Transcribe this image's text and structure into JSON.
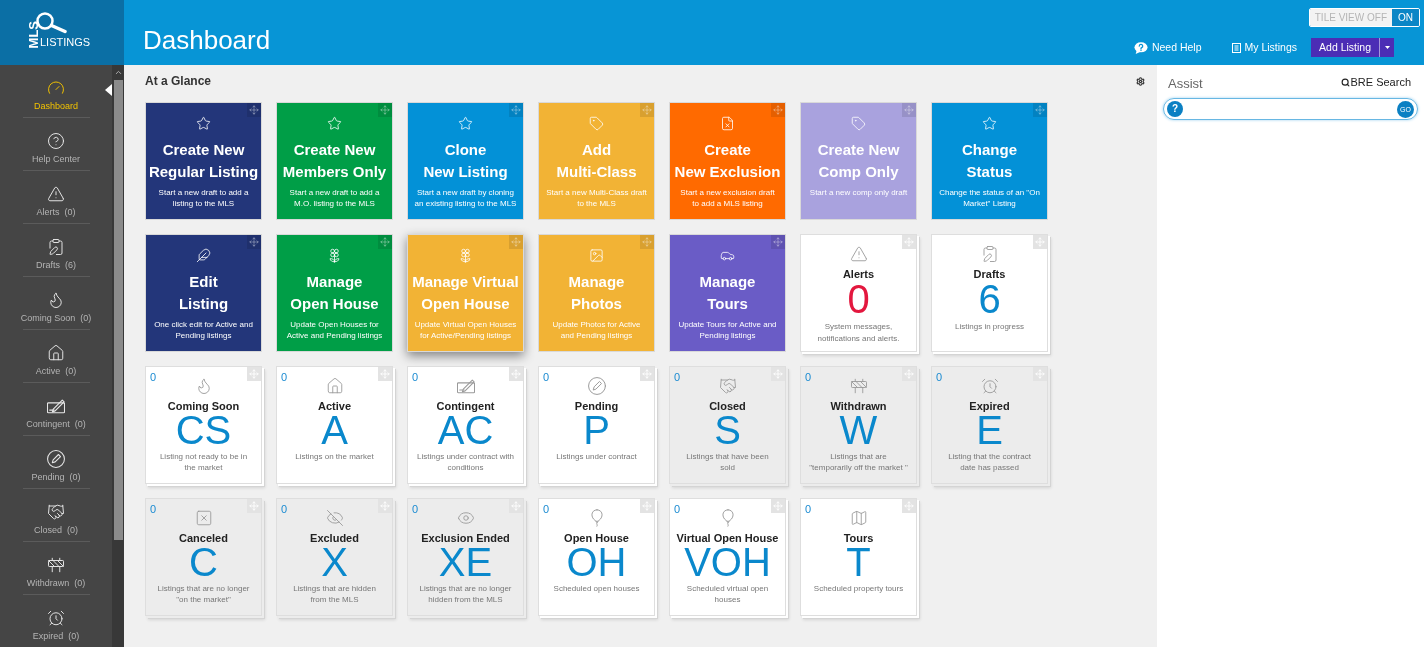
{
  "logo": {
    "vertical_text": "MLS",
    "text": "LISTINGS"
  },
  "header": {
    "title": "Dashboard",
    "tile_view_toggle": {
      "off_label": "TILE VIEW OFF",
      "on_label": "ON",
      "on": true
    },
    "links": [
      {
        "kind": "help",
        "label": "Need Help"
      },
      {
        "kind": "listings",
        "label": "My Listings"
      }
    ],
    "add_listing": {
      "label": "Add Listing"
    }
  },
  "sidebar": {
    "items": [
      {
        "kind": "dashboard",
        "label": "Dashboard",
        "selected": true
      },
      {
        "kind": "help",
        "label": "Help Center",
        "selected": false
      },
      {
        "kind": "alerts",
        "label": "Alerts",
        "count": "(0)",
        "selected": false
      },
      {
        "kind": "drafts",
        "label": "Drafts",
        "count": "(6)",
        "selected": false
      },
      {
        "kind": "upcoming",
        "label": "Coming Soon",
        "count": "(0)",
        "selected": false
      },
      {
        "kind": "active",
        "label": "Active",
        "count": "(0)",
        "selected": false
      },
      {
        "kind": "contingent",
        "label": "Contingent",
        "count": "(0)",
        "selected": false
      },
      {
        "kind": "pending",
        "label": "Pending",
        "count": "(0)",
        "selected": false
      },
      {
        "kind": "closed",
        "label": "Closed",
        "count": "(0)",
        "selected": false
      },
      {
        "kind": "withdrawn",
        "label": "Withdrawn",
        "count": "(0)",
        "selected": false
      },
      {
        "kind": "expired",
        "label": "Expired",
        "count": "(0)",
        "selected": false
      }
    ]
  },
  "glance": {
    "title": "At a Glance",
    "tiles": [
      {
        "kind": "create",
        "title": [
          "Create New",
          "Regular Listing"
        ],
        "description": "Start a new draft to add a listing to the MLS",
        "color": "#23367a",
        "hovered": false
      },
      {
        "kind": "create",
        "title": [
          "Create New",
          "Members Only"
        ],
        "description": "Start a new draft to add a M.O. listing to the MLS",
        "color": "#009e47",
        "hovered": false
      },
      {
        "kind": "clone",
        "title": [
          "Clone",
          "New Listing"
        ],
        "description": "Start a new draft by cloning an existing listing to the MLS",
        "color": "#0391d7",
        "hovered": false
      },
      {
        "kind": "multiclass",
        "title": [
          "Add",
          "Multi-Class"
        ],
        "description": "Start a new Multi-Class draft to the MLS",
        "color": "#f2b335",
        "hovered": false
      },
      {
        "kind": "exclusion",
        "title": [
          "Create",
          "New Exclusion"
        ],
        "description": "Start a new exclusion draft to add a MLS listing",
        "color": "#ff6a00",
        "hovered": false
      },
      {
        "kind": "comp",
        "title": [
          "Create New",
          "Comp Only"
        ],
        "description": "Start a new comp only draft",
        "color": "#a9a2de",
        "hovered": false
      },
      {
        "kind": "status",
        "title": [
          "Change",
          "Status"
        ],
        "description": "Change the status of an \"On Market\" Listing",
        "color": "#0391d7",
        "hovered": false
      },
      {
        "kind": "edit",
        "title": [
          "Edit",
          "Listing"
        ],
        "description": "One click edit for Active and Pending listings",
        "color": "#23367a",
        "hovered": false
      },
      {
        "kind": "manageopenhouse",
        "title": [
          "Manage",
          "Open House"
        ],
        "description": "Update Open Houses for Active and Pending listings",
        "color": "#009e47",
        "hovered": false
      },
      {
        "kind": "managevirtual",
        "title": [
          "Manage Virtual",
          "Open House"
        ],
        "description": "Update Virtual Open Houses for Active/Pending listings",
        "color": "#f2b335",
        "hovered": true
      },
      {
        "kind": "managephotos",
        "title": [
          "Manage",
          "Photos"
        ],
        "description": "Update Photos for Active and Pending listings",
        "color": "#f2b335",
        "hovered": false
      },
      {
        "kind": "managetours",
        "title": [
          "Manage",
          "Tours"
        ],
        "description": "Update Tours for Active and Pending listings",
        "color": "#6a5cc6",
        "hovered": false
      },
      {
        "kind": "alerts",
        "label": "Alerts",
        "value": "0",
        "color": "#e3173e",
        "description": "System messages, notifications and alerts.",
        "hovered": false
      },
      {
        "kind": "drafts",
        "label": "Drafts",
        "value": "6",
        "color": "#0a88cc",
        "description": "Listings in progress",
        "hovered": false
      },
      {
        "kind": "upcoming",
        "count": "0",
        "label": "Coming Soon",
        "code": "CS",
        "description": "Listing not ready to be in the market",
        "shaded": false,
        "hovered": false
      },
      {
        "kind": "active",
        "count": "0",
        "label": "Active",
        "code": "A",
        "description": "Listings on the market",
        "shaded": false,
        "hovered": false
      },
      {
        "kind": "contingent",
        "count": "0",
        "label": "Contingent",
        "code": "AC",
        "description": "Listings under contract with conditions",
        "shaded": false,
        "hovered": false
      },
      {
        "kind": "pending",
        "count": "0",
        "label": "Pending",
        "code": "P",
        "description": "Listings under contract",
        "shaded": false,
        "hovered": false
      },
      {
        "kind": "closed",
        "count": "0",
        "label": "Closed",
        "code": "S",
        "description": "Listings that have been sold",
        "shaded": true,
        "hovered": false
      },
      {
        "kind": "withdrawn",
        "count": "0",
        "label": "Withdrawn",
        "code": "W",
        "description": "Listings that are \"temporarily off the market \"",
        "shaded": true,
        "hovered": false
      },
      {
        "kind": "expired",
        "count": "0",
        "label": "Expired",
        "code": "E",
        "description": "Listing that the contract date has passed",
        "shaded": true,
        "hovered": false
      },
      {
        "kind": "canceled",
        "count": "0",
        "label": "Canceled",
        "code": "C",
        "description": "Listings that are no longer \"on the market\"",
        "shaded": true,
        "hovered": false
      },
      {
        "kind": "excluded",
        "count": "0",
        "label": "Excluded",
        "code": "X",
        "description": "Listings that are hidden from the MLS",
        "shaded": true,
        "hovered": false
      },
      {
        "kind": "unexcluded",
        "count": "0",
        "label": "Exclusion Ended",
        "code": "XE",
        "description": "Listings that are no longer hidden from the MLS",
        "shaded": true,
        "hovered": false
      },
      {
        "kind": "openhouse",
        "count": "0",
        "label": "Open House",
        "code": "OH",
        "description": "Scheduled open houses",
        "shaded": false,
        "hovered": false
      },
      {
        "kind": "virtualopenhouse",
        "count": "0",
        "label": "Virtual Open House",
        "code": "VOH",
        "description": "Scheduled virtual open houses",
        "shaded": false,
        "hovered": false
      },
      {
        "kind": "tours",
        "count": "0",
        "label": "Tours",
        "code": "T",
        "description": "Scheduled property tours",
        "shaded": false,
        "hovered": false
      }
    ]
  },
  "assist": {
    "title": "Assist",
    "search_link": "BRE Search",
    "search_field": {
      "help_label": "?",
      "go_label": "GO"
    }
  }
}
